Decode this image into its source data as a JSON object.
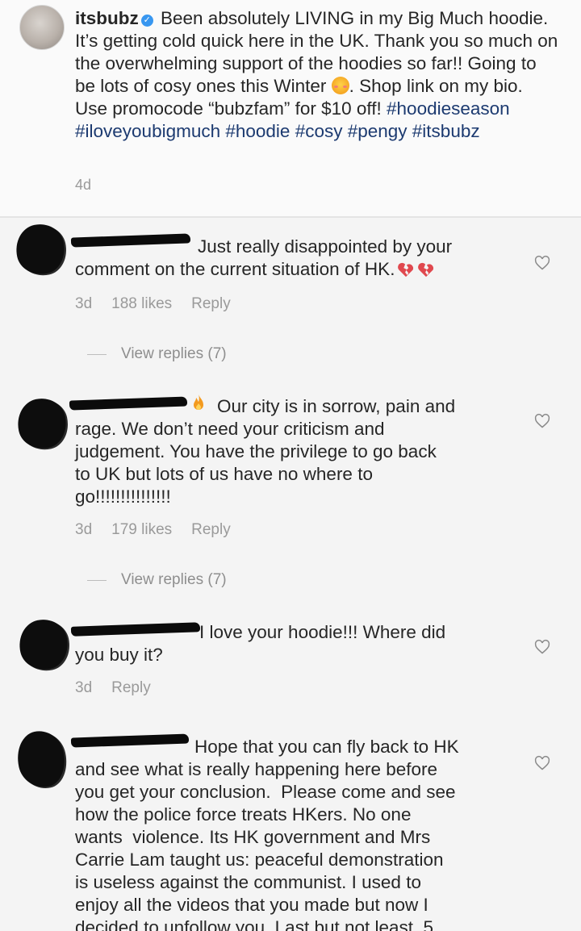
{
  "post": {
    "username": "itsbubz",
    "verified_icon": "verified-badge-icon",
    "caption_part1": " Been absolutely LIVING in my Big Much hoodie. It’s getting cold quick here in the UK. Thank you so much on the overwhelming support of the hoodies so far!! Going to be lots of cosy ones this Winter ",
    "caption_emoji": "smiling-face-with-hearts-emoji",
    "caption_part2": ". Shop link on my bio. Use promocode “bubzfam” for $10 off! ",
    "hashtags": "#hoodieseason #iloveyoubigmuch #hoodie #cosy #pengy #itsbubz",
    "time": "4d"
  },
  "comments": [
    {
      "text": "Just really disappointed by your\ncomment on the current situation of HK.",
      "emoji": "broken-heart-icon",
      "time": "3d",
      "likes": "188 likes",
      "reply": "Reply",
      "view_replies": "View replies (7)"
    },
    {
      "text": "Our city is in sorrow, pain and\nrage. We don’t need your criticism and\njudgement. You have the privilege to go back\nto UK but lots of us have no where to\ngo!!!!!!!!!!!!!!!",
      "emoji": "fire-icon",
      "time": "3d",
      "likes": "179 likes",
      "reply": "Reply",
      "view_replies": "View replies (7)"
    },
    {
      "text": "I love your hoodie!!! Where did\nyou buy it?",
      "time": "3d",
      "reply": "Reply"
    },
    {
      "text": "Hope that you can fly back to HK\nand see what is really happening here before\nyou get your conclusion.  Please come and see\nhow the police force treats HKers. No one\nwants  violence. Its HK government and Mrs\nCarrie Lam taught us: peaceful demonstration\nis useless against the communist. I used to\nenjoy all the videos that you made but now I\ndecided to unfollow you. Last but not least, 5"
    }
  ],
  "colors": {
    "hashtag": "#1c3a70",
    "meta_text": "#9a9a9a",
    "broken_heart": "#e0484e"
  }
}
